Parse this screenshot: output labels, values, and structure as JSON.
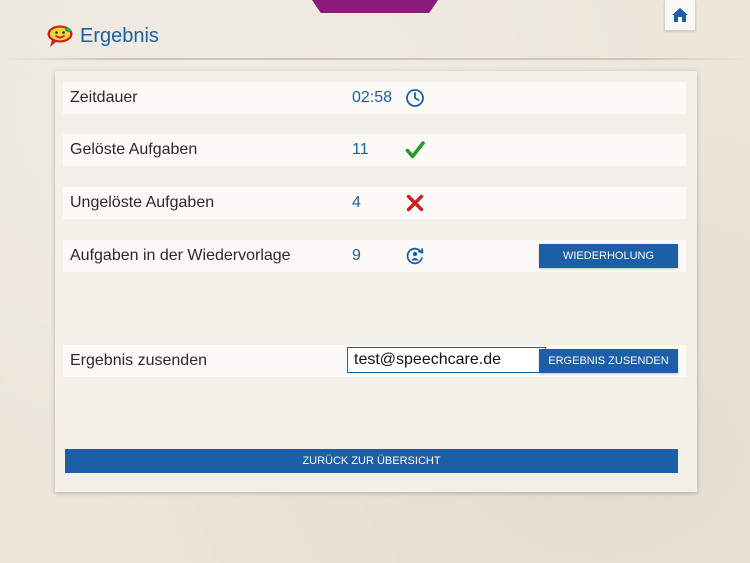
{
  "header": {
    "title": "Ergebnis",
    "logo_icon": "speech-bubble-face-icon",
    "home_icon": "home-icon"
  },
  "colors": {
    "accent": "#1d5fa6",
    "top_tab": "#8a1a7c",
    "check": "#2a9a2a",
    "cross": "#d11f1f"
  },
  "results": {
    "duration": {
      "label": "Zeitdauer",
      "value": "02:58",
      "icon": "clock-icon"
    },
    "solved": {
      "label": "Gelöste Aufgaben",
      "value": "11",
      "icon": "checkmark-icon"
    },
    "unsolved": {
      "label": "Ungelöste Aufgaben",
      "value": "4",
      "icon": "cross-icon"
    },
    "resubmission": {
      "label": "Aufgaben in der Wiedervorlage",
      "value": "9",
      "icon": "repeat-icon",
      "button_label": "Wiederholung"
    }
  },
  "send": {
    "label": "Ergebnis zusenden",
    "email_value": "test@speechcare.de",
    "button_label": "Ergebnis zusenden"
  },
  "footer": {
    "back_label": "Zurück zur Übersicht"
  }
}
